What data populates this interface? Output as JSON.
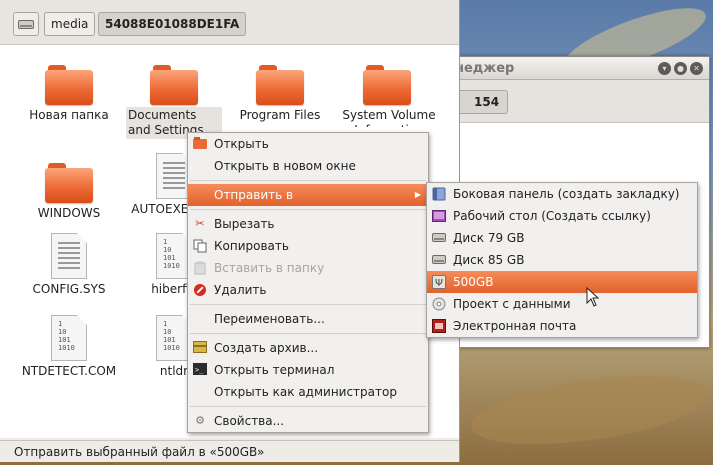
{
  "back_window": {
    "title": "неджер",
    "crumb": "154",
    "buttons": [
      "▾",
      "●",
      "✕"
    ]
  },
  "toolbar": {
    "drive_icon": "drive-icon",
    "crumbs": [
      "media",
      "54088E01088DE1FA"
    ]
  },
  "files": [
    {
      "label": "Новая папка",
      "type": "folder"
    },
    {
      "label": "Documents and Settings",
      "type": "folder"
    },
    {
      "label": "Program Files",
      "type": "folder"
    },
    {
      "label": "System Volume Information",
      "type": "folder"
    },
    {
      "label": "WINDOWS",
      "type": "folder"
    },
    {
      "label": "AUTOEXEC",
      "type": "text"
    },
    {
      "label": "CONFIG.SYS",
      "type": "text"
    },
    {
      "label": "hiberfil.",
      "type": "binary"
    },
    {
      "label": "NTDETECT.COM",
      "type": "binary"
    },
    {
      "label": "ntldr",
      "type": "binary"
    }
  ],
  "context_menu": {
    "open": "Открыть",
    "open_new_window": "Открыть в новом окне",
    "send_to": "Отправить в",
    "cut": "Вырезать",
    "copy": "Копировать",
    "paste_into": "Вставить в папку",
    "delete": "Удалить",
    "rename": "Переименовать...",
    "create_archive": "Создать архив...",
    "open_terminal": "Открыть терминал",
    "open_as_admin": "Открыть как администратор",
    "properties": "Свойства..."
  },
  "submenu": {
    "side_panel": "Боковая панель (создать закладку)",
    "desktop": "Рабочий стол (Создать ссылку)",
    "disk79": "Диск 79 GB",
    "disk85": "Диск 85 GB",
    "usb": "500GB",
    "data_project": "Проект с данными",
    "email": "Электронная почта"
  },
  "status": "Отправить выбранный файл в «500GB»",
  "colors": {
    "accent": "#e9682f",
    "folder": "#ee6a35"
  }
}
